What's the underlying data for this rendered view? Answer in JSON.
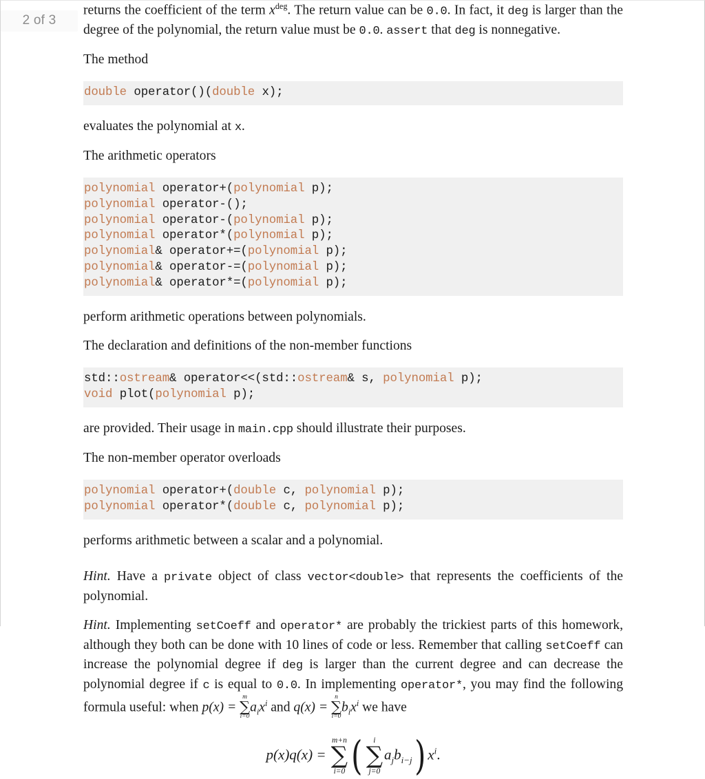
{
  "viewer": {
    "page_indicator": "2 of 3"
  },
  "document": {
    "paragraphs": {
      "p1_a": "returns the coefficient of the term ",
      "p1_x": "x",
      "p1_deg": "deg",
      "p1_b": ". The return value can be ",
      "p1_c1": "0.0",
      "p1_c": ". In fact, it ",
      "p1_c2": "deg",
      "p1_d": " is larger than the degree of the polynomial, the return value must be ",
      "p1_c3": "0.0",
      "p1_e": ". ",
      "p1_c4": "assert",
      "p1_f": " that ",
      "p1_c5": "deg",
      "p1_g": " is nonnegative.",
      "p2": "The method",
      "p3_a": "evaluates the polynomial at ",
      "p3_code": "x",
      "p3_b": ".",
      "p4": "The arithmetic operators",
      "p5": "perform arithmetic operations between polynomials.",
      "p6": "The declaration and definitions of the non-member functions",
      "p7_a": "are provided. Their usage in ",
      "p7_code": "main.cpp",
      "p7_b": " should illustrate their purposes.",
      "p8": "The non-member operator overloads",
      "p9": "performs arithmetic between a scalar and a polynomial.",
      "hint1_label": "Hint.",
      "hint1_a": " Have a ",
      "hint1_c1": "private",
      "hint1_b": " object of class ",
      "hint1_c2": "vector<double>",
      "hint1_c": " that represents the coefficients of the polynomial.",
      "hint2_label": "Hint.",
      "hint2_a": " Implementing ",
      "hint2_c1": "setCoeff",
      "hint2_b": " and ",
      "hint2_c2": "operator*",
      "hint2_c": " are probably the trickiest parts of this homework, although they both can be done with 10 lines of code or less. Remember that calling ",
      "hint2_c3": "setCoeff",
      "hint2_d": " can increase the polynomial degree if ",
      "hint2_c4": "deg",
      "hint2_e": " is larger than the current degree and can decrease the polynomial degree if ",
      "hint2_c5": "c",
      "hint2_f": " is equal to ",
      "hint2_c6": "0.0",
      "hint2_g": ". In implementing ",
      "hint2_c7": "operator*",
      "hint2_h": ", you may find the following formula useful: when "
    },
    "code_blocks": {
      "block1": {
        "lines": [
          [
            {
              "t": "double",
              "k": true
            },
            {
              "t": " operator()(",
              "k": false
            },
            {
              "t": "double",
              "k": true
            },
            {
              "t": " x);",
              "k": false
            }
          ]
        ]
      },
      "block2": {
        "lines": [
          [
            {
              "t": "polynomial",
              "k": true
            },
            {
              "t": " operator+(",
              "k": false
            },
            {
              "t": "polynomial",
              "k": true
            },
            {
              "t": " p);",
              "k": false
            }
          ],
          [
            {
              "t": "polynomial",
              "k": true
            },
            {
              "t": " operator-();",
              "k": false
            }
          ],
          [
            {
              "t": "polynomial",
              "k": true
            },
            {
              "t": " operator-(",
              "k": false
            },
            {
              "t": "polynomial",
              "k": true
            },
            {
              "t": " p);",
              "k": false
            }
          ],
          [
            {
              "t": "polynomial",
              "k": true
            },
            {
              "t": " operator*(",
              "k": false
            },
            {
              "t": "polynomial",
              "k": true
            },
            {
              "t": " p);",
              "k": false
            }
          ],
          [
            {
              "t": "polynomial",
              "k": true
            },
            {
              "t": "& operator+=(",
              "k": false
            },
            {
              "t": "polynomial",
              "k": true
            },
            {
              "t": " p);",
              "k": false
            }
          ],
          [
            {
              "t": "polynomial",
              "k": true
            },
            {
              "t": "& operator-=(",
              "k": false
            },
            {
              "t": "polynomial",
              "k": true
            },
            {
              "t": " p);",
              "k": false
            }
          ],
          [
            {
              "t": "polynomial",
              "k": true
            },
            {
              "t": "& operator*=(",
              "k": false
            },
            {
              "t": "polynomial",
              "k": true
            },
            {
              "t": " p);",
              "k": false
            }
          ]
        ]
      },
      "block3": {
        "lines": [
          [
            {
              "t": "std::",
              "k": false
            },
            {
              "t": "ostream",
              "k": true
            },
            {
              "t": "& operator<<(std::",
              "k": false
            },
            {
              "t": "ostream",
              "k": true
            },
            {
              "t": "& s, ",
              "k": false
            },
            {
              "t": "polynomial",
              "k": true
            },
            {
              "t": " p);",
              "k": false
            }
          ],
          [
            {
              "t": "void",
              "k": true
            },
            {
              "t": " plot(",
              "k": false
            },
            {
              "t": "polynomial",
              "k": true
            },
            {
              "t": " p);",
              "k": false
            }
          ]
        ]
      },
      "block4": {
        "lines": [
          [
            {
              "t": "polynomial",
              "k": true
            },
            {
              "t": " operator+(",
              "k": false
            },
            {
              "t": "double",
              "k": true
            },
            {
              "t": " c, ",
              "k": false
            },
            {
              "t": "polynomial",
              "k": true
            },
            {
              "t": " p);",
              "k": false
            }
          ],
          [
            {
              "t": "polynomial",
              "k": true
            },
            {
              "t": " operator*(",
              "k": false
            },
            {
              "t": "double",
              "k": true
            },
            {
              "t": " c, ",
              "k": false
            },
            {
              "t": "polynomial",
              "k": true
            },
            {
              "t": " p);",
              "k": false
            }
          ]
        ]
      }
    },
    "math": {
      "inline_px": "p(x) = ",
      "inline_sum_upper_m": "m",
      "inline_sum_lower": "i=0",
      "inline_ai": "a",
      "inline_ai_sub": "i",
      "inline_x": "x",
      "inline_x_sup": "i",
      "and_text": " and ",
      "inline_qx": "q(x) = ",
      "inline_sum_upper_n": "n",
      "inline_bi": "b",
      "inline_bi_sub": "i",
      "we_have": " we have",
      "display_lhs": "p(x)q(x) = ",
      "display_outer_upper": "m+n",
      "display_outer_lower": "i=0",
      "display_inner_upper": "i",
      "display_inner_lower": "j=0",
      "display_aj": "a",
      "display_aj_sub": "j",
      "display_b": "b",
      "display_b_sub": "i−j",
      "display_x": "x",
      "display_x_sup": "i",
      "display_period": "."
    }
  },
  "colors": {
    "code_keyword": "#c27b52",
    "code_background": "#f0f0f0",
    "page_indicator_text": "#8d8d8d"
  }
}
